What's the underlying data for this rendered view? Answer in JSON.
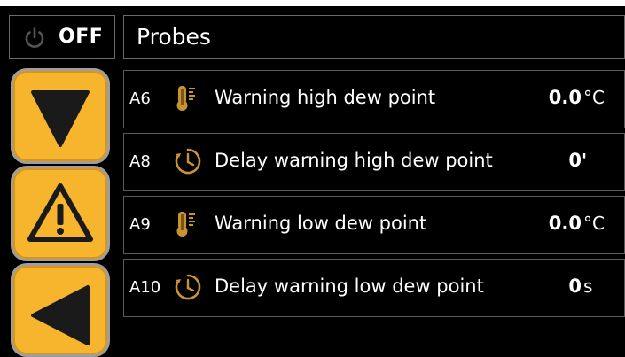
{
  "power": {
    "icon": "power-icon",
    "label": "OFF"
  },
  "header": {
    "title": "Probes"
  },
  "sidebar": {
    "buttons": [
      {
        "icon": "arrow-down-icon"
      },
      {
        "icon": "alarm-warning-icon"
      },
      {
        "icon": "arrow-back-icon"
      }
    ]
  },
  "rows": [
    {
      "code": "A6",
      "icon": "thermometer-icon",
      "label": "Warning high dew point",
      "value": "0.0",
      "unit": "°C"
    },
    {
      "code": "A8",
      "icon": "clock-icon",
      "label": "Delay warning high dew point",
      "value": "0",
      "unit": "'"
    },
    {
      "code": "A9",
      "icon": "thermometer-icon",
      "label": "Warning low dew point",
      "value": "0.0",
      "unit": "°C"
    },
    {
      "code": "A10",
      "icon": "clock-icon",
      "label": "Delay warning low dew point",
      "value": "0",
      "unit": "s"
    }
  ],
  "colors": {
    "accent": "#f7b52d",
    "border": "#6a6a6a",
    "background": "#000000"
  }
}
